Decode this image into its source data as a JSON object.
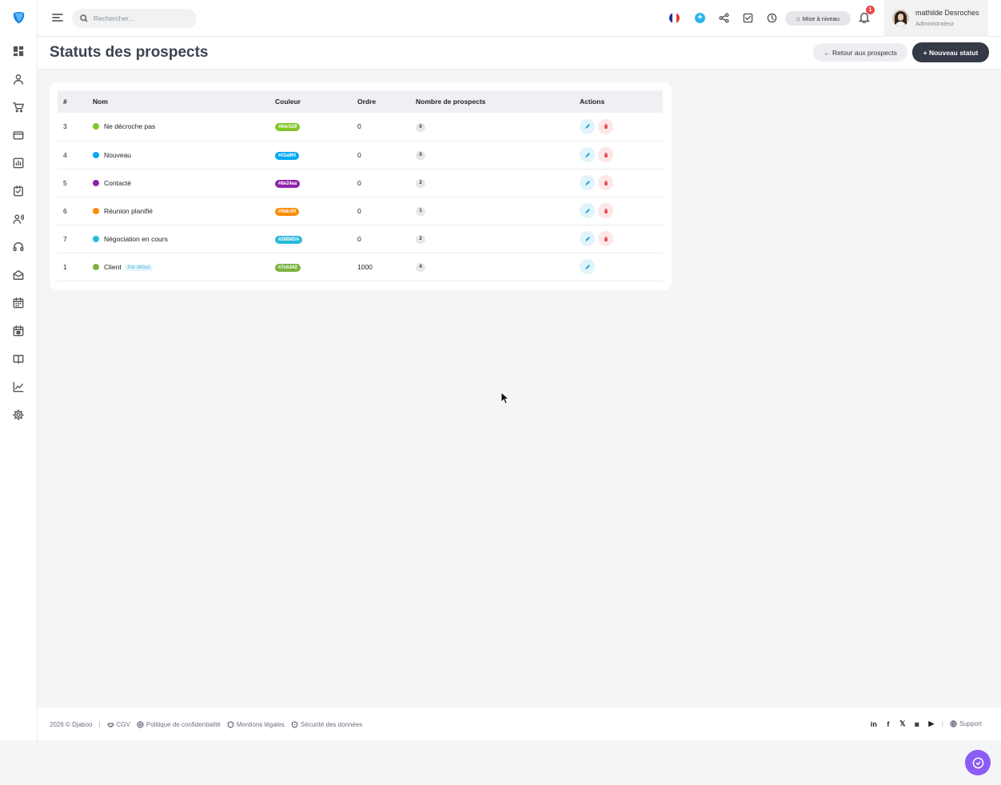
{
  "search": {
    "placeholder": "Rechercher..."
  },
  "topbar": {
    "upgrade_label": "Mise à niveau",
    "notifications_count": "1",
    "user_name": "mathilde Desroches",
    "user_role": "Administrateur"
  },
  "header": {
    "title": "Statuts des prospects",
    "back_label": "← Retour aux prospects",
    "new_label": "+ Nouveau statut"
  },
  "table": {
    "columns": [
      "#",
      "Nom",
      "Couleur",
      "Ordre",
      "Nombre de prospects",
      "Actions"
    ],
    "rows": [
      {
        "id": "3",
        "name": "Ne décroche pas",
        "color": "#84c529",
        "order": "0",
        "count": "0",
        "default": "",
        "deletable": true
      },
      {
        "id": "4",
        "name": "Nouveau",
        "color": "#03a9f4",
        "order": "0",
        "count": "0",
        "default": "",
        "deletable": true
      },
      {
        "id": "5",
        "name": "Contacté",
        "color": "#8e24aa",
        "order": "0",
        "count": "2",
        "default": "",
        "deletable": true
      },
      {
        "id": "6",
        "name": "Réunion planifié",
        "color": "#fb8c00",
        "order": "0",
        "count": "1",
        "default": "",
        "deletable": true
      },
      {
        "id": "7",
        "name": "Négociation en cours",
        "color": "#28B8DA",
        "order": "0",
        "count": "2",
        "default": "",
        "deletable": true
      },
      {
        "id": "1",
        "name": "Client",
        "color": "#7cb342",
        "order": "1000",
        "count": "4",
        "default": "Par défaut",
        "deletable": false
      }
    ]
  },
  "footer": {
    "copyright": "2026 © Djaboo",
    "links": [
      "CGV",
      "Politique de confidentialité",
      "Mentions légales",
      "Sécurité des données"
    ],
    "support_label": "Support"
  },
  "colors": {
    "accent": "#343a46",
    "brand": "#1e88e5",
    "chat": "#8b5cf6"
  }
}
